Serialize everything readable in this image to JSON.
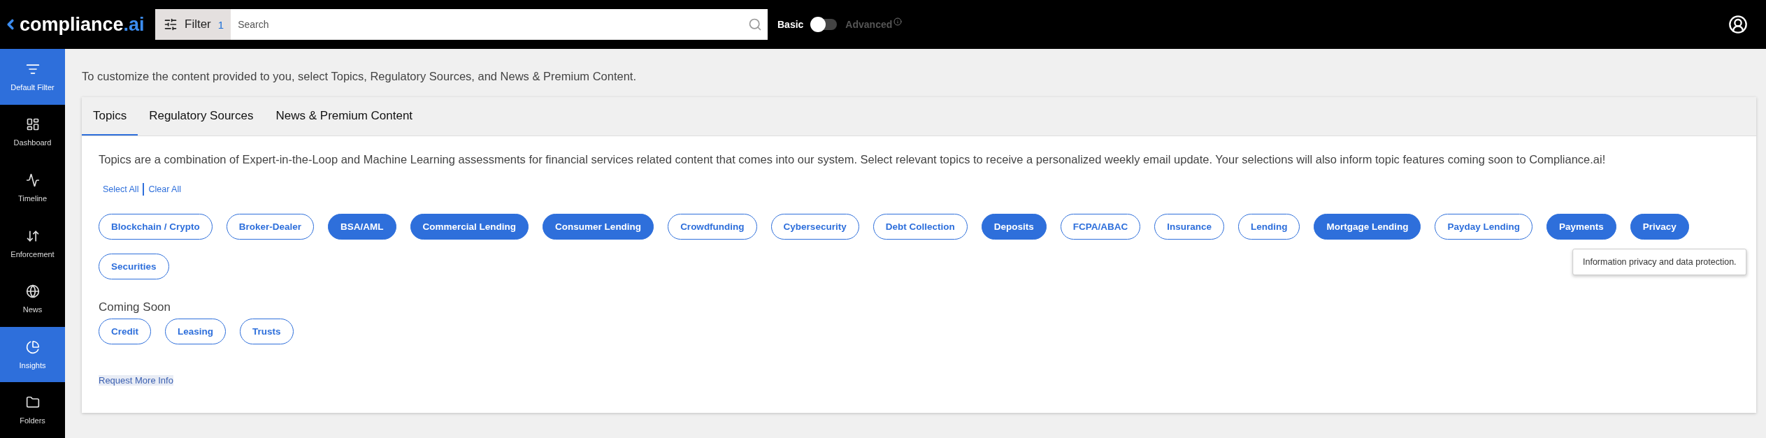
{
  "header": {
    "logo": {
      "brand": "compliance",
      "suffix": ".ai"
    },
    "filter": {
      "label": "Filter",
      "count": "1"
    },
    "search": {
      "placeholder": "Search"
    },
    "mode_toggle": {
      "left_label": "Basic",
      "right_label": "Advanced",
      "on": false
    }
  },
  "sidebar": {
    "items": [
      {
        "kind": "filter",
        "label": "Default Filter",
        "selected": true
      },
      {
        "kind": "dashboard",
        "label": "Dashboard",
        "selected": false
      },
      {
        "kind": "timeline",
        "label": "Timeline",
        "selected": false
      },
      {
        "kind": "enforcement",
        "label": "Enforcement",
        "selected": false
      },
      {
        "kind": "news",
        "label": "News",
        "selected": false
      },
      {
        "kind": "insights",
        "label": "Insights",
        "selected": true
      },
      {
        "kind": "folders",
        "label": "Folders",
        "selected": false
      }
    ]
  },
  "intro": "To customize the content provided to you, select Topics, Regulatory Sources, and News & Premium Content.",
  "tabs": [
    {
      "label": "Topics",
      "selected": true
    },
    {
      "label": "Regulatory Sources",
      "selected": false
    },
    {
      "label": "News & Premium Content",
      "selected": false
    }
  ],
  "description": "Topics are a combination of Expert-in-the-Loop and Machine Learning assessments for financial services related content that comes into our system. Select relevant topics to receive a personalized weekly email update. Your selections will also inform topic features coming soon to Compliance.ai!",
  "links": [
    "Select All",
    "Clear All"
  ],
  "topics": [
    {
      "label": "Blockchain / Crypto",
      "selected": false
    },
    {
      "label": "Broker-Dealer",
      "selected": false
    },
    {
      "label": "BSA/AML",
      "selected": true
    },
    {
      "label": "Commercial Lending",
      "selected": true
    },
    {
      "label": "Consumer Lending",
      "selected": true
    },
    {
      "label": "Crowdfunding",
      "selected": false
    },
    {
      "label": "Cybersecurity",
      "selected": false
    },
    {
      "label": "Debt Collection",
      "selected": false
    },
    {
      "label": "Deposits",
      "selected": true
    },
    {
      "label": "FCPA/ABAC",
      "selected": false
    },
    {
      "label": "Insurance",
      "selected": false
    },
    {
      "label": "Lending",
      "selected": false
    },
    {
      "label": "Mortgage Lending",
      "selected": true
    },
    {
      "label": "Payday Lending",
      "selected": false
    },
    {
      "label": "Payments",
      "selected": true
    },
    {
      "label": "Privacy",
      "selected": true,
      "tooltip": "Information privacy and data protection."
    },
    {
      "label": "Securities",
      "selected": false
    }
  ],
  "coming_soon": {
    "heading": "Coming Soon",
    "topics": [
      {
        "label": "Credit",
        "selected": false
      },
      {
        "label": "Leasing",
        "selected": false
      },
      {
        "label": "Trusts",
        "selected": false
      }
    ]
  },
  "request_link": "Request More Info"
}
